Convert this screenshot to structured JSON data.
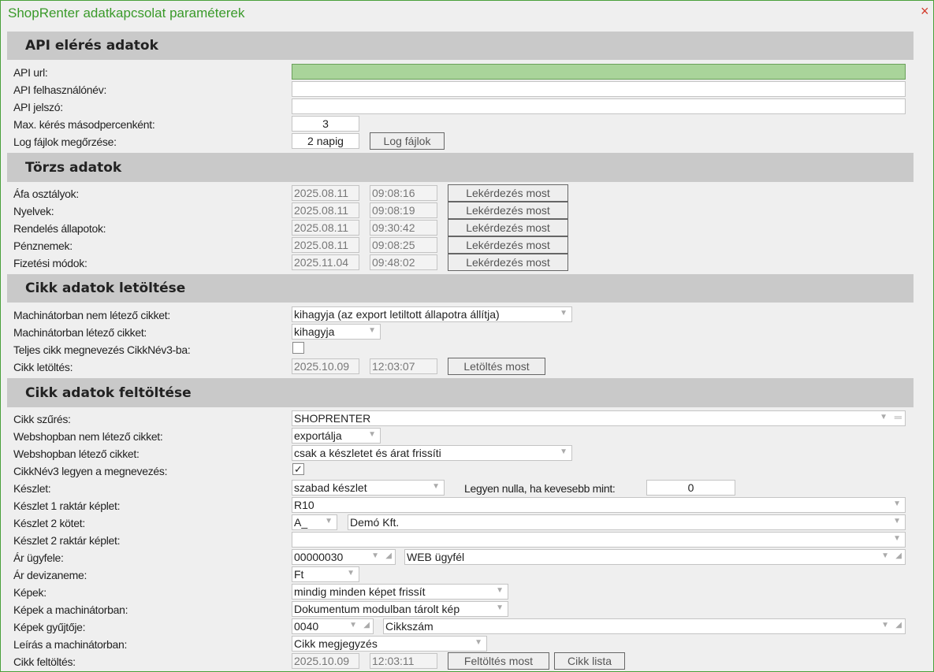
{
  "window": {
    "title": "ShopRenter adatkapcsolat paraméterek",
    "close_icon": "×"
  },
  "api": {
    "header": "API elérés adatok",
    "url_label": "API url:",
    "url_value": "",
    "user_label": "API felhasználónév:",
    "user_value": "",
    "pass_label": "API jelszó:",
    "pass_value": "",
    "max_label": "Max. kérés másodpercenként:",
    "max_value": "3",
    "log_label": "Log fájlok megőrzése:",
    "log_value": "2 napig",
    "log_button": "Log fájlok"
  },
  "torzs": {
    "header": "Törzs adatok",
    "button": "Lekérdezés most",
    "rows": [
      {
        "label": "Áfa osztályok:",
        "date": "2025.08.11",
        "time": "09:08:16"
      },
      {
        "label": "Nyelvek:",
        "date": "2025.08.11",
        "time": "09:08:19"
      },
      {
        "label": "Rendelés állapotok:",
        "date": "2025.08.11",
        "time": "09:30:42"
      },
      {
        "label": "Pénznemek:",
        "date": "2025.08.11",
        "time": "09:08:25"
      },
      {
        "label": "Fizetési módok:",
        "date": "2025.11.04",
        "time": "09:48:02"
      }
    ]
  },
  "letoltes": {
    "header": "Cikk adatok letöltése",
    "nem_letezo_label": "Machinátorban nem létező cikket:",
    "nem_letezo_value": "kihagyja (az export letiltott állapotra állítja)",
    "letezo_label": "Machinátorban létező cikket:",
    "letezo_value": "kihagyja",
    "teljes_label": "Teljes cikk megnevezés CikkNév3-ba:",
    "teljes_checked": false,
    "letoltes_label": "Cikk letöltés:",
    "date": "2025.10.09",
    "time": "12:03:07",
    "button": "Letöltés most"
  },
  "feltoltes": {
    "header": "Cikk adatok feltöltése",
    "szures_label": "Cikk szűrés:",
    "szures_value": "SHOPRENTER",
    "ws_nem_label": "Webshopban nem létező cikket:",
    "ws_nem_value": "exportálja",
    "ws_letezo_label": "Webshopban létező cikket:",
    "ws_letezo_value": "csak a készletet és árat frissíti",
    "cikknev3_label": "CikkNév3 legyen a megnevezés:",
    "cikknev3_checked": true,
    "check_mark": "✓",
    "keszlet_label": "Készlet:",
    "keszlet_value": "szabad készlet",
    "nulla_label": "Legyen nulla, ha kevesebb mint:",
    "nulla_value": "0",
    "k1_label": "Készlet 1 raktár képlet:",
    "k1_value": "R10",
    "k2kotet_label": "Készlet 2 kötet:",
    "k2kotet_code": "A_",
    "k2kotet_name": "Demó Kft.",
    "k2_label": "Készlet 2 raktár képlet:",
    "k2_value": "",
    "ar_ugyfel_label": "Ár ügyfele:",
    "ar_ugyfel_code": "00000030",
    "ar_ugyfel_name": "WEB ügyfél",
    "deviza_label": "Ár devizaneme:",
    "deviza_value": "Ft",
    "kepek_label": "Képek:",
    "kepek_value": "mindig minden képet frissít",
    "kepek_m_label": "Képek a machinátorban:",
    "kepek_m_value": "Dokumentum modulban tárolt kép",
    "gyujto_label": "Képek gyűjtője:",
    "gyujto_code": "0040",
    "gyujto_name": "Cikkszám",
    "leiras_label": "Leírás a machinátorban:",
    "leiras_value": "Cikk megjegyzés",
    "feltoltes_label": "Cikk feltöltés:",
    "date": "2025.10.09",
    "time": "12:03:11",
    "button": "Feltöltés most",
    "lista_button": "Cikk lista"
  }
}
